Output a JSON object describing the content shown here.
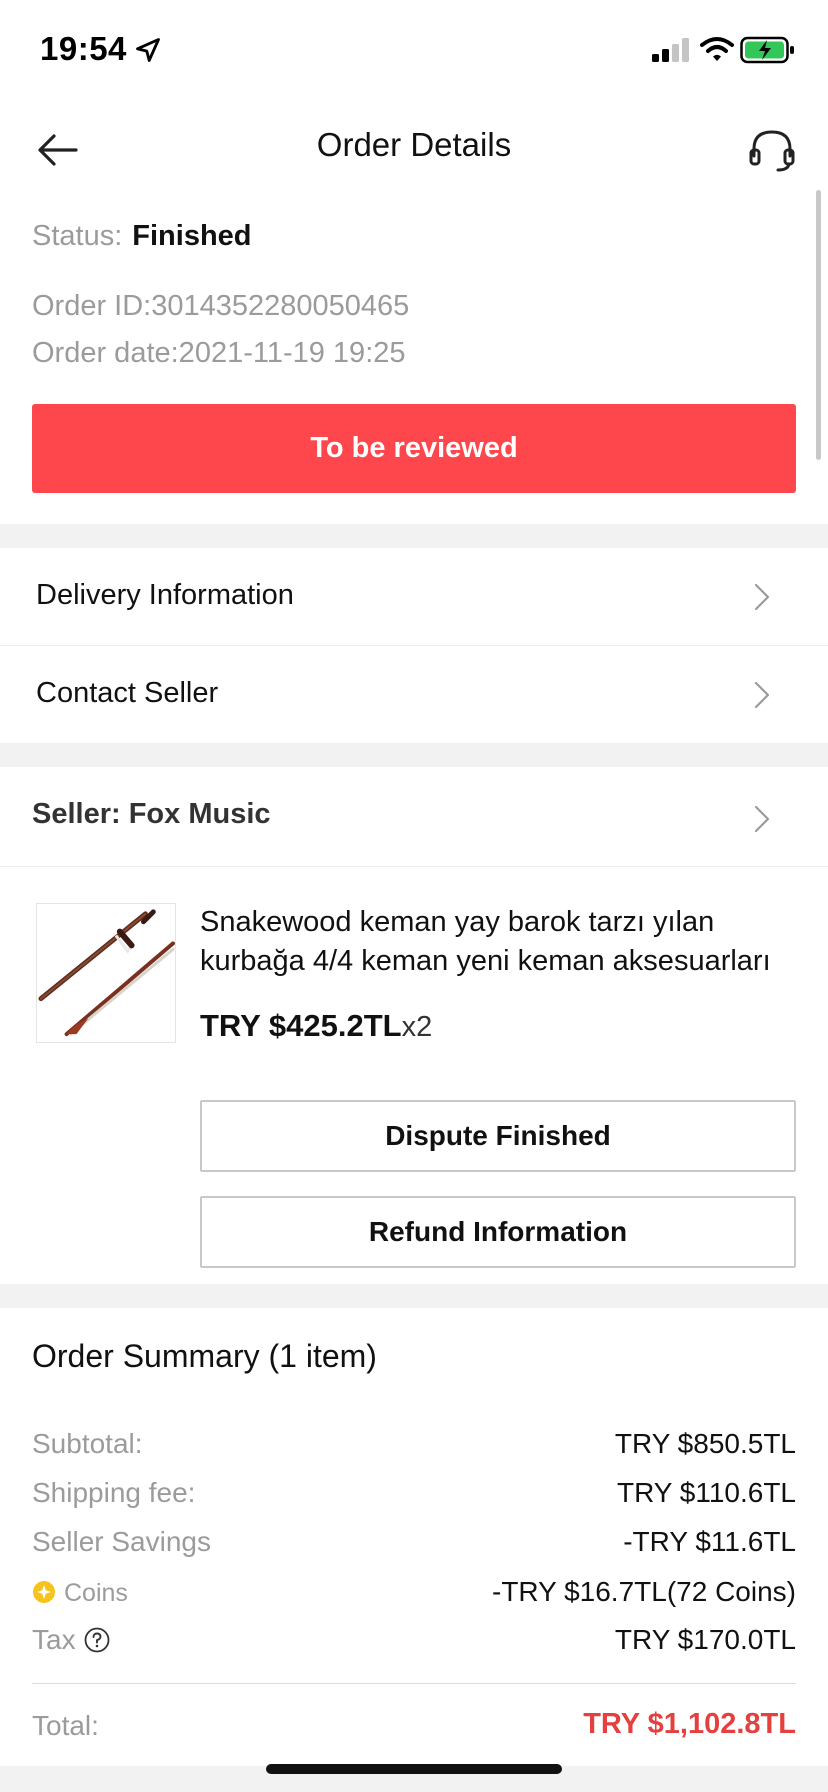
{
  "status_bar": {
    "time": "19:54"
  },
  "nav": {
    "title": "Order Details"
  },
  "order": {
    "status_label": "Status:",
    "status_value": "Finished",
    "order_id": "Order ID:3014352280050465",
    "order_date": "Order date:2021-11-19 19:25",
    "review_button": "To be reviewed"
  },
  "menu": {
    "delivery": "Delivery Information",
    "contact": "Contact Seller",
    "seller": "Seller: Fox Music"
  },
  "product": {
    "title": "Snakewood keman yay barok tarzı yılan kurbağa 4/4 keman yeni keman aksesuarları",
    "price": "TRY $425.2TL",
    "quantity": "x2",
    "dispute_button": "Dispute Finished",
    "refund_button": "Refund Information"
  },
  "summary": {
    "title": "Order Summary (1 item)",
    "rows": [
      {
        "label": "Subtotal:",
        "value": "TRY $850.5TL"
      },
      {
        "label": "Shipping fee:",
        "value": "TRY $110.6TL"
      },
      {
        "label": "Seller Savings",
        "value": "-TRY $11.6TL"
      },
      {
        "label": "Coins",
        "value": "-TRY $16.7TL(72 Coins)"
      },
      {
        "label": "Tax",
        "value": "TRY $170.0TL"
      }
    ],
    "total_label": "Total:",
    "total_value": "TRY $1,102.8TL"
  },
  "colors": {
    "accent": "#fd474c",
    "total": "#e4403f",
    "coin": "#f6c21c"
  },
  "icons": [
    "location-arrow-icon",
    "signal-icon",
    "wifi-icon",
    "battery-charging-icon",
    "back-arrow-icon",
    "support-headset-icon",
    "chevron-right-icon",
    "coin-icon",
    "help-icon"
  ]
}
